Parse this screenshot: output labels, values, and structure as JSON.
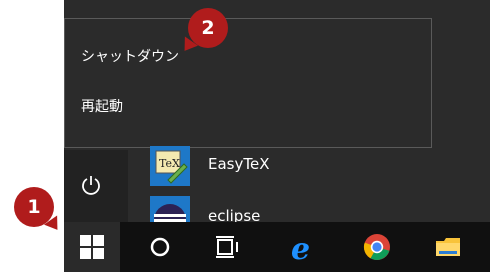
{
  "power_menu": {
    "shutdown_label": "シャットダウン",
    "restart_label": "再起動"
  },
  "apps": [
    {
      "label": "EasyTeX",
      "icon": "easytex-icon"
    },
    {
      "label": "eclipse",
      "icon": "eclipse-icon"
    }
  ],
  "taskbar": {
    "icons": [
      "windows-start-icon",
      "cortana-circle-icon",
      "task-view-icon",
      "edge-browser-icon",
      "chrome-browser-icon",
      "file-explorer-icon"
    ]
  },
  "annotations": [
    {
      "number": "1"
    },
    {
      "number": "2"
    }
  ],
  "colors": {
    "menu_bg": "#2b2b2b",
    "taskbar_bg": "#101010",
    "badge": "#b01c1c",
    "accent": "#1e78c8"
  }
}
